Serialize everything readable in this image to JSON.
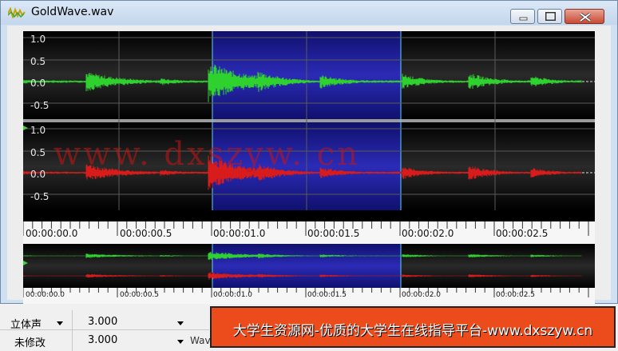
{
  "window": {
    "title": "GoldWave.wav",
    "icon": "goldwave-app-icon",
    "buttons": {
      "minimize": "minimize-icon",
      "maximize": "maximize-icon",
      "close": "close-icon"
    }
  },
  "waveform": {
    "channel_top": {
      "color": "#2fd12f",
      "amp_labels": [
        "1.0",
        "0.5",
        "0.0",
        "-0.5"
      ]
    },
    "channel_bottom": {
      "color": "#d81b1b",
      "amp_labels": [
        "1.0",
        "0.5",
        "0.0",
        "-0.5"
      ]
    },
    "selection": {
      "start": "00:00:01.0",
      "end": "00:00:02.0",
      "color": "#1a1aa8"
    },
    "time_labels": [
      "00:00:00.0",
      "00:00:00.5",
      "00:00:01.0",
      "00:00:01.5",
      "00:00:02.0",
      "00:00:02.5"
    ]
  },
  "overview": {
    "time_labels": [
      "00:00:00.0",
      "00:00:00.5",
      "00:00:01.0",
      "00:00:01.5",
      "00:00:02.0",
      "00:00:02.5"
    ]
  },
  "watermark": "www. dxszyw. cn",
  "status": {
    "channels": "立体声",
    "modified": "未修改",
    "length_1": "3.000",
    "length_2": "3.000",
    "format_prefix": "Wav"
  },
  "banner": {
    "text": "大学生资源网-优质的大学生在线指导平台-www.dxszyw.cn"
  }
}
